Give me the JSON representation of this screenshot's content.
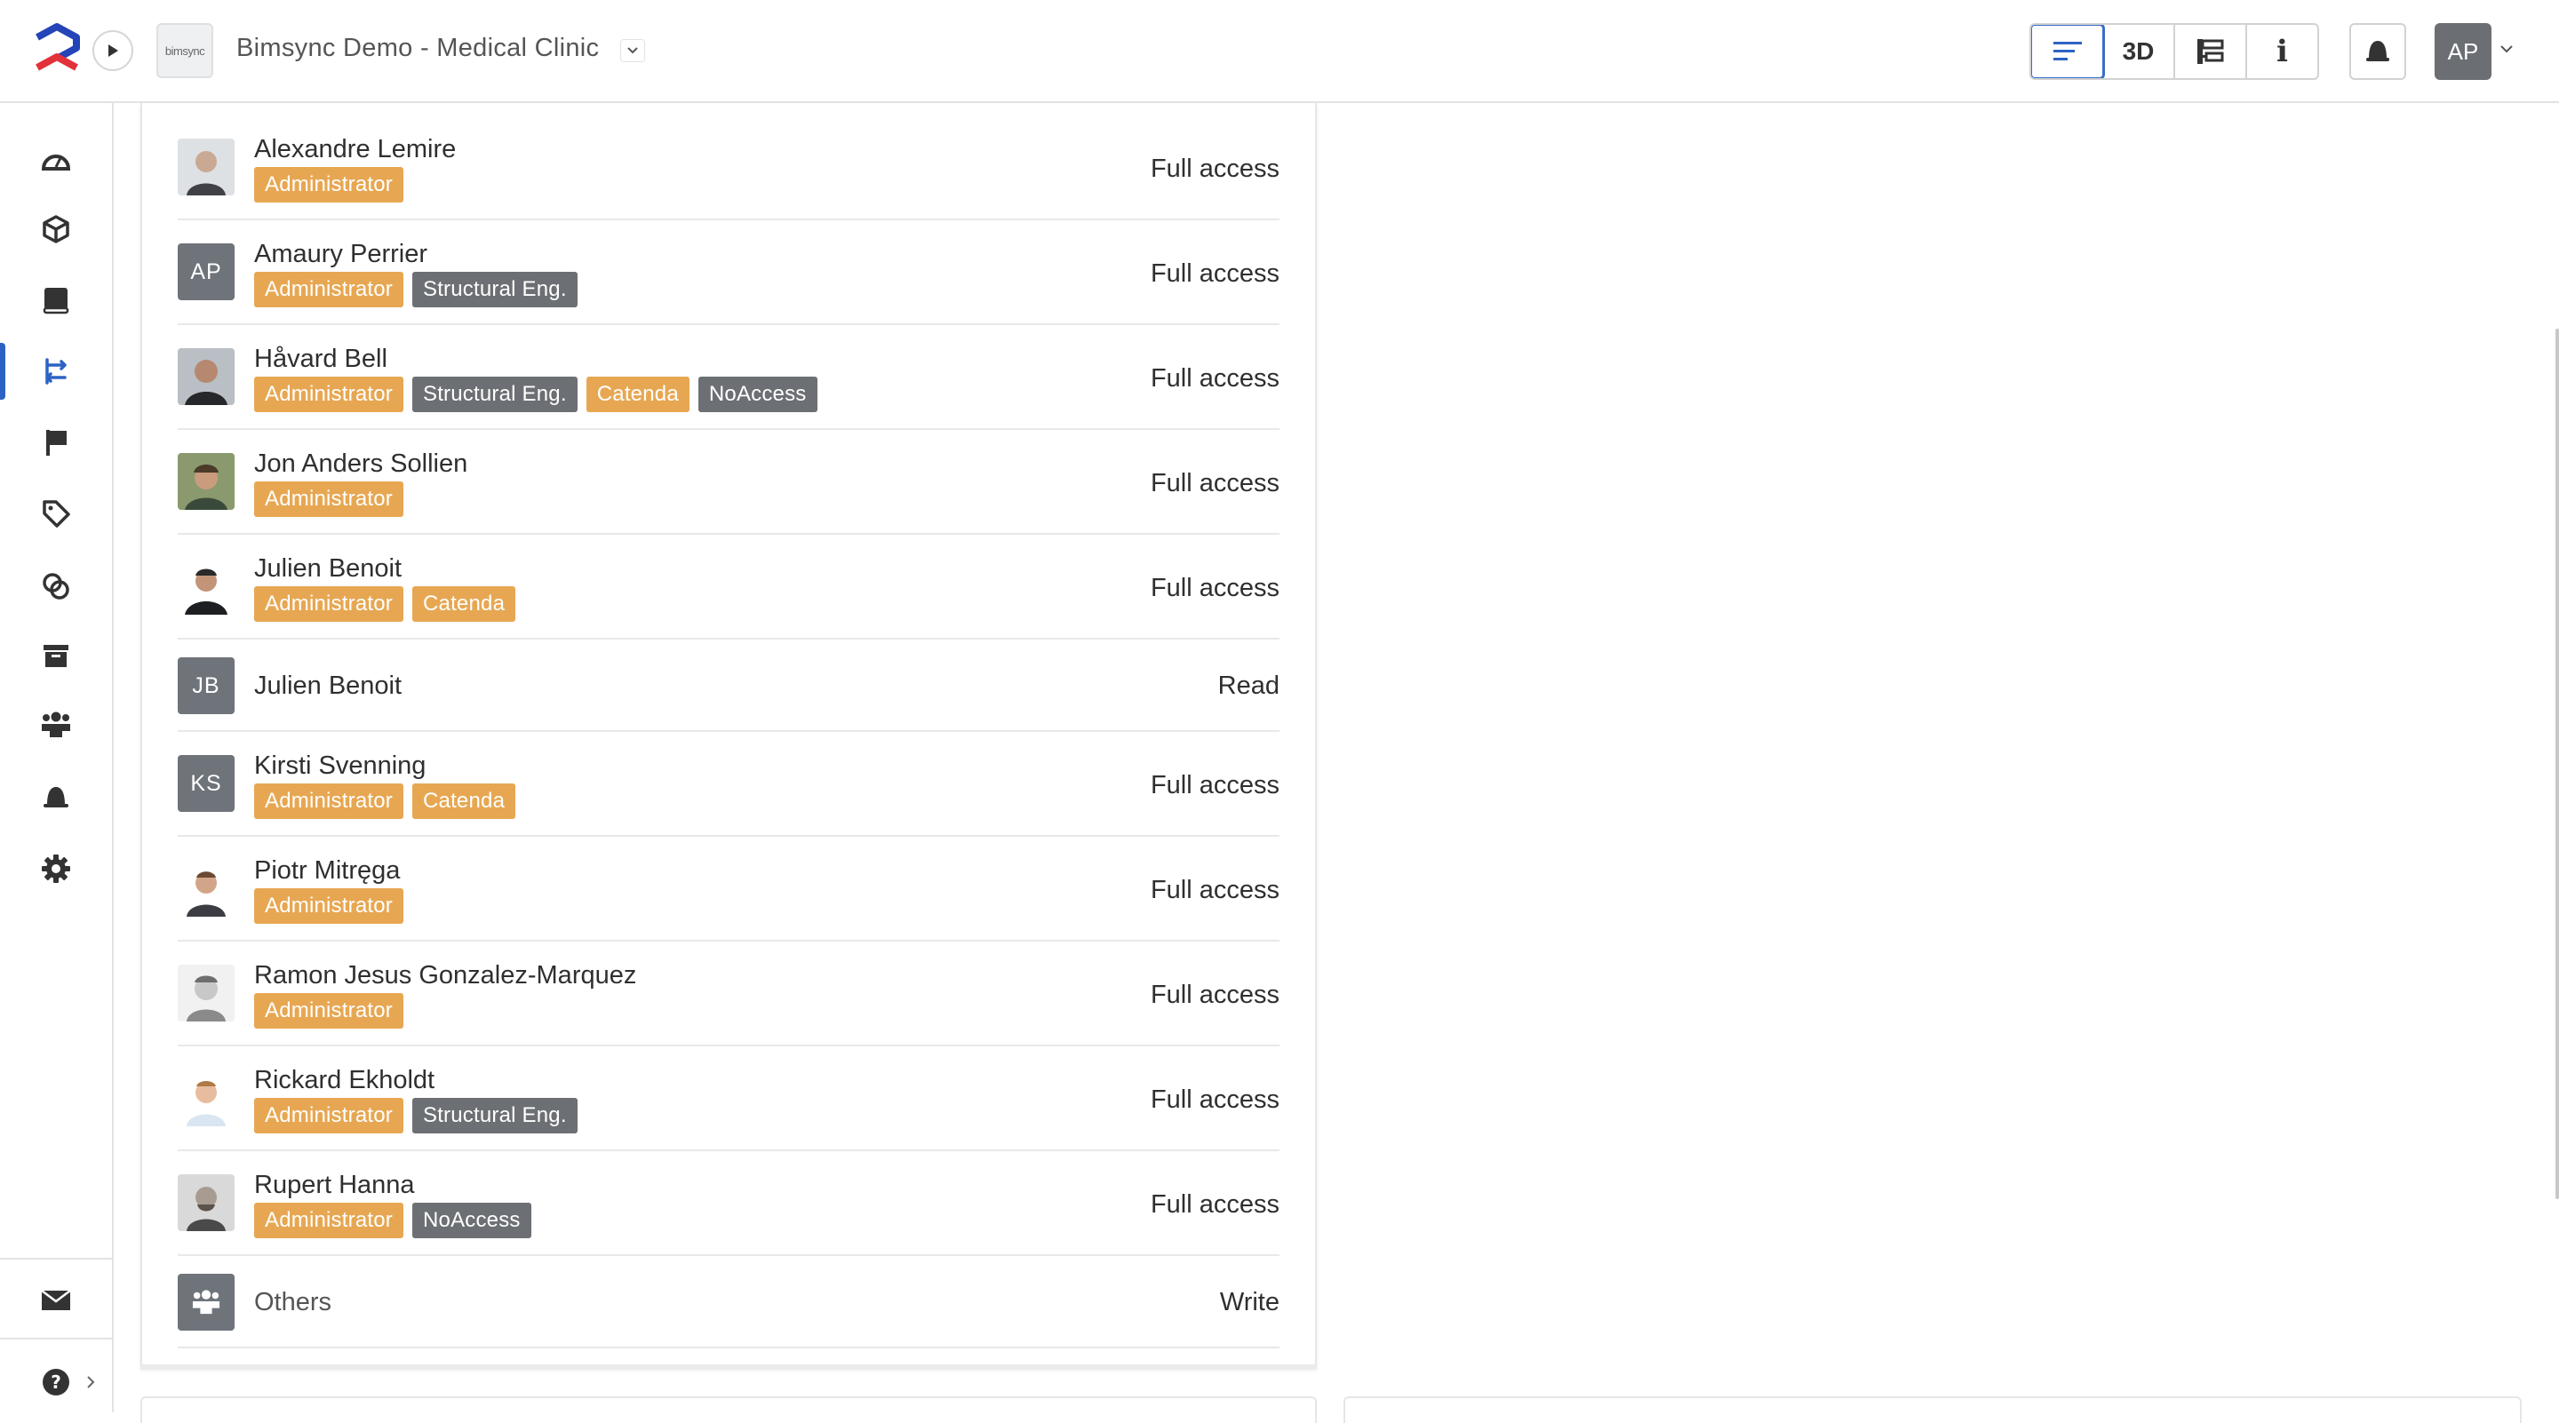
{
  "header": {
    "project_title": "Bimsync Demo - Medical Clinic",
    "project_thumb_text": "bimsync",
    "views": [
      {
        "label": "",
        "icon": "list-icon",
        "active": true
      },
      {
        "label": "3D",
        "icon": "",
        "active": false
      },
      {
        "label": "",
        "icon": "tree-icon",
        "active": false
      },
      {
        "label": "i",
        "icon": "info-icon",
        "active": false
      }
    ],
    "user_initials": "AP"
  },
  "sidebar": {
    "items": [
      {
        "name": "dashboard",
        "icon": "gauge-icon",
        "active": false
      },
      {
        "name": "models",
        "icon": "cube-icon",
        "active": false
      },
      {
        "name": "library",
        "icon": "book-icon",
        "active": false
      },
      {
        "name": "issues",
        "icon": "issue-flow-icon",
        "active": true
      },
      {
        "name": "flags",
        "icon": "flag-icon",
        "active": false
      },
      {
        "name": "tags",
        "icon": "tag-icon",
        "active": false
      },
      {
        "name": "links",
        "icon": "link-circles-icon",
        "active": false
      },
      {
        "name": "archive",
        "icon": "archive-icon",
        "active": false
      },
      {
        "name": "members",
        "icon": "team-icon",
        "active": false
      },
      {
        "name": "notifications",
        "icon": "bell-icon",
        "active": false
      },
      {
        "name": "settings",
        "icon": "gear-icon",
        "active": false
      }
    ],
    "footer": [
      {
        "name": "inbox",
        "icon": "mail-icon"
      },
      {
        "name": "help",
        "icon": "help-icon"
      }
    ]
  },
  "members": [
    {
      "name": "Alexandre Lemire",
      "avatar": "photo",
      "initials": "",
      "tags": [
        {
          "label": "Administrator",
          "color": "orange"
        }
      ],
      "access": "Full access"
    },
    {
      "name": "Amaury Perrier",
      "avatar": "initials",
      "initials": "AP",
      "tags": [
        {
          "label": "Administrator",
          "color": "orange"
        },
        {
          "label": "Structural Eng.",
          "color": "gray"
        }
      ],
      "access": "Full access"
    },
    {
      "name": "Håvard Bell",
      "avatar": "photo",
      "initials": "",
      "tags": [
        {
          "label": "Administrator",
          "color": "orange"
        },
        {
          "label": "Structural Eng.",
          "color": "gray"
        },
        {
          "label": "Catenda",
          "color": "orange"
        },
        {
          "label": "NoAccess",
          "color": "gray"
        }
      ],
      "access": "Full access"
    },
    {
      "name": "Jon Anders Sollien",
      "avatar": "photo",
      "initials": "",
      "tags": [
        {
          "label": "Administrator",
          "color": "orange"
        }
      ],
      "access": "Full access"
    },
    {
      "name": "Julien Benoit",
      "avatar": "photo",
      "initials": "",
      "tags": [
        {
          "label": "Administrator",
          "color": "orange"
        },
        {
          "label": "Catenda",
          "color": "orange"
        }
      ],
      "access": "Full access"
    },
    {
      "name": "Julien Benoit",
      "avatar": "initials",
      "initials": "JB",
      "tags": [],
      "access": "Read"
    },
    {
      "name": "Kirsti Svenning",
      "avatar": "initials",
      "initials": "KS",
      "tags": [
        {
          "label": "Administrator",
          "color": "orange"
        },
        {
          "label": "Catenda",
          "color": "orange"
        }
      ],
      "access": "Full access"
    },
    {
      "name": "Piotr Mitręga",
      "avatar": "photo",
      "initials": "",
      "tags": [
        {
          "label": "Administrator",
          "color": "orange"
        }
      ],
      "access": "Full access"
    },
    {
      "name": "Ramon Jesus Gonzalez-Marquez",
      "avatar": "photo",
      "initials": "",
      "tags": [
        {
          "label": "Administrator",
          "color": "orange"
        }
      ],
      "access": "Full access"
    },
    {
      "name": "Rickard Ekholdt",
      "avatar": "photo",
      "initials": "",
      "tags": [
        {
          "label": "Administrator",
          "color": "orange"
        },
        {
          "label": "Structural Eng.",
          "color": "gray"
        }
      ],
      "access": "Full access"
    },
    {
      "name": "Rupert Hanna",
      "avatar": "photo",
      "initials": "",
      "tags": [
        {
          "label": "Administrator",
          "color": "orange"
        },
        {
          "label": "NoAccess",
          "color": "gray"
        }
      ],
      "access": "Full access"
    },
    {
      "name": "Others",
      "avatar": "group",
      "initials": "",
      "tags": [],
      "access": "Write"
    }
  ],
  "colors": {
    "accent": "#2d62c4",
    "tag_orange": "#e7a752",
    "tag_gray": "#6c6f73",
    "logo_blue": "#2444b8",
    "logo_red": "#e2313a"
  }
}
